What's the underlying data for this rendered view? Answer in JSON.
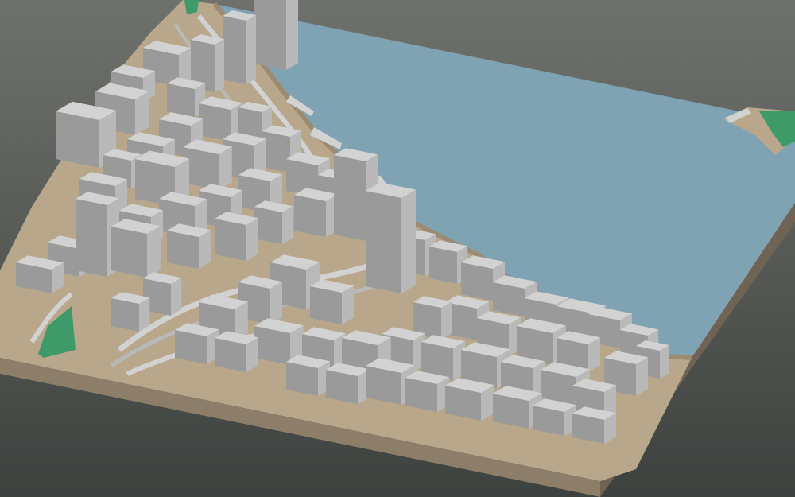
{
  "scene": {
    "subject": "3d-city-model",
    "colors": {
      "background_top": "#6f716c",
      "background_bottom": "#3e423f",
      "water": "#7fa3b3",
      "terrain": "#b9a78c",
      "terrain_dark": "#9c8b72",
      "base_side": "#8c7e69",
      "base_side_dark": "#6f6453",
      "vegetation": "#3f9a6a",
      "building_light": "#d2d2d2",
      "building_mid": "#b9b9b9",
      "building_dark": "#9a9a9a"
    }
  }
}
